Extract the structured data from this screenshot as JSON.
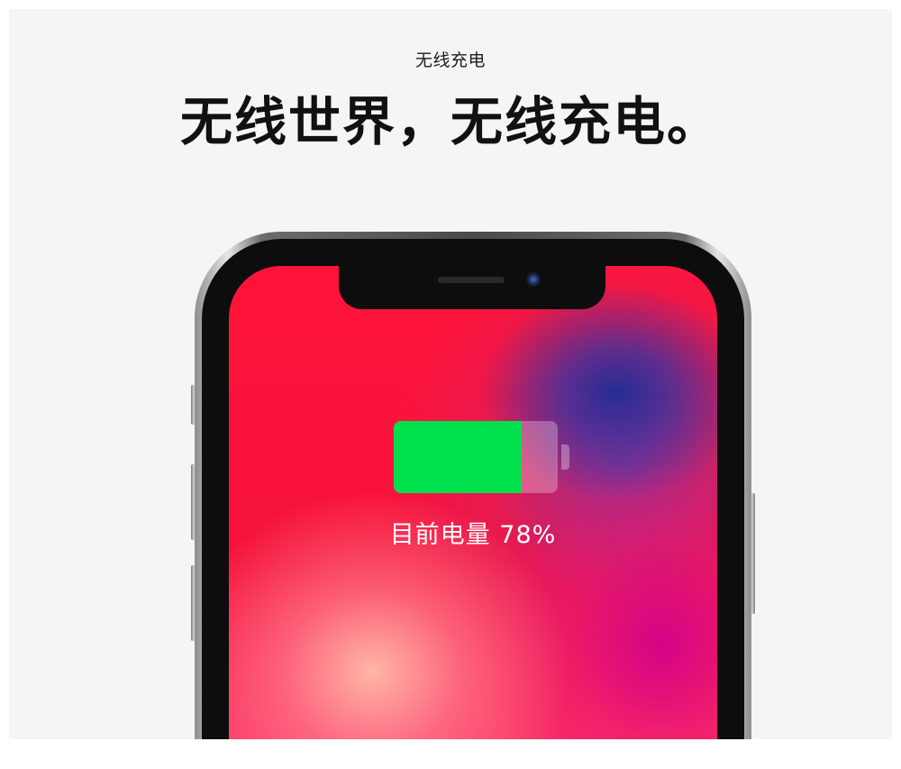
{
  "header": {
    "eyebrow": "无线充电",
    "headline": "无线世界，无线充电。"
  },
  "device": {
    "battery_label": "目前电量 78%",
    "battery_level": 0.78,
    "battery_fill_color": "#00e04d"
  },
  "colors": {
    "background": "#f5f5f7",
    "headline": "#111111",
    "screen_red": "#ff1338",
    "screen_blue": "#1e2d96",
    "screen_magenta": "#d2008c"
  }
}
